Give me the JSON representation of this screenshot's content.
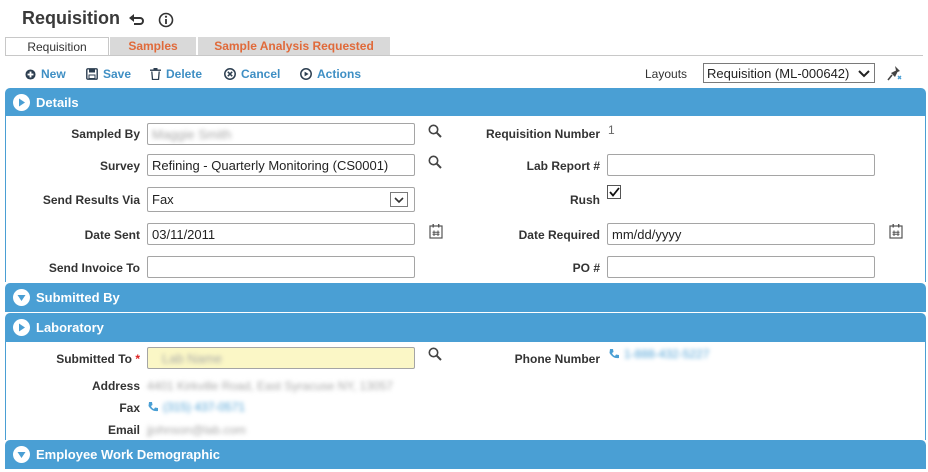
{
  "page": {
    "title": "Requisition"
  },
  "tabs": [
    {
      "label": "Requisition",
      "active": true
    },
    {
      "label": "Samples",
      "active": false
    },
    {
      "label": "Sample Analysis Requested",
      "active": false
    }
  ],
  "toolbar": {
    "new": "New",
    "save": "Save",
    "delete": "Delete",
    "cancel": "Cancel",
    "actions": "Actions",
    "layouts_label": "Layouts",
    "layout_value": "Requisition (ML-000642)"
  },
  "sections": {
    "details": "Details",
    "submitted_by": "Submitted By",
    "laboratory": "Laboratory",
    "employee": "Employee Work Demographic"
  },
  "details": {
    "sampled_by_label": "Sampled By",
    "sampled_by_value": "Maggie Smith",
    "survey_label": "Survey",
    "survey_value": "Refining - Quarterly Monitoring (CS0001)",
    "send_results_label": "Send Results Via",
    "send_results_value": "Fax",
    "date_sent_label": "Date Sent",
    "date_sent_value": "03/11/2011",
    "send_invoice_label": "Send Invoice To",
    "send_invoice_value": "",
    "req_number_label": "Requisition Number",
    "req_number_value": "1",
    "lab_report_label": "Lab Report #",
    "lab_report_value": "",
    "rush_label": "Rush",
    "rush_checked": true,
    "date_required_label": "Date Required",
    "date_required_placeholder": "mm/dd/yyyy",
    "po_label": "PO #",
    "po_value": ""
  },
  "laboratory": {
    "submitted_to_label": "Submitted To",
    "submitted_to_value": "Lab Name",
    "required_mark": "*",
    "phone_label": "Phone Number",
    "phone_value": "1-888-432-5227",
    "address_label": "Address",
    "address_value": "4401 Kirkville Road, East Syracuse NY, 13057",
    "fax_label": "Fax",
    "fax_value": "(315) 437-0571",
    "email_label": "Email",
    "email_value": "jjohnson@lab.com"
  },
  "colors": {
    "accent": "#4a9fd4",
    "link": "#3f8fc4",
    "tab_text": "#e06a3a",
    "required_bg": "#fbf7c6"
  }
}
